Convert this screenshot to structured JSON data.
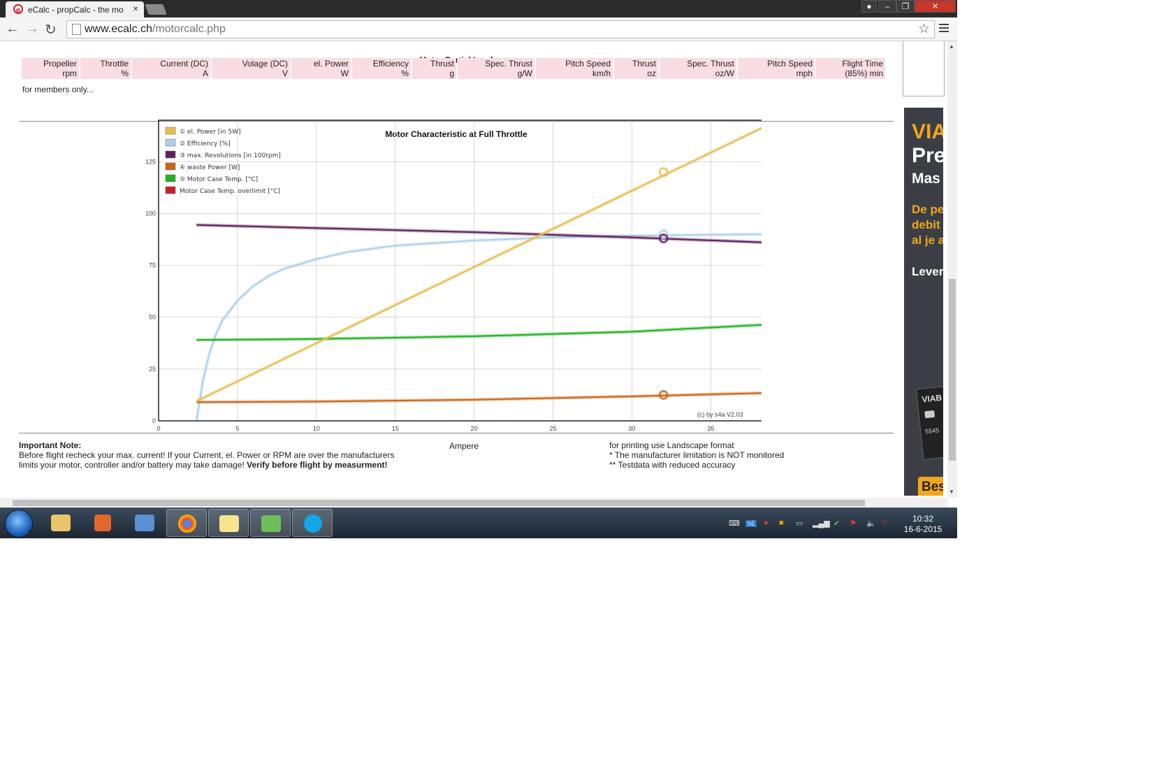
{
  "browser": {
    "tab_title": "eCalc - propCalc - the mo",
    "tab_close": "×",
    "url_host": "www.ecalc.ch",
    "url_path": "/motorcalc.php",
    "window_buttons": {
      "minimize": "–",
      "maximize": "❐",
      "close": "✕"
    }
  },
  "partial_load": {
    "title": "Motor Partial Load",
    "columns": [
      {
        "line1": "Propeller",
        "line2": "rpm"
      },
      {
        "line1": "Throttle",
        "line2": "%"
      },
      {
        "line1": "Current (DC)",
        "line2": "A"
      },
      {
        "line1": "Volage (DC)",
        "line2": "V"
      },
      {
        "line1": "el. Power",
        "line2": "W"
      },
      {
        "line1": "Efficiency",
        "line2": "%"
      },
      {
        "line1": "Thrust",
        "line2": "g"
      },
      {
        "line1": "Spec. Thrust",
        "line2": "g/W"
      },
      {
        "line1": "Pitch Speed",
        "line2": "km/h"
      },
      {
        "line1": "Thrust",
        "line2": "oz"
      },
      {
        "line1": "Spec. Thrust",
        "line2": "oz/W"
      },
      {
        "line1": "Pitch Speed",
        "line2": "mph"
      },
      {
        "line1": "Flight Time",
        "line2": "(85%) min"
      }
    ],
    "members_note": "for members only..."
  },
  "chart_data": {
    "type": "line",
    "title": "Motor Characteristic at Full Throttle",
    "xlabel": "Ampere",
    "ylabel": "",
    "xlim": [
      0,
      38.7
    ],
    "ylim": [
      0,
      145
    ],
    "x_ticks": [
      0,
      5,
      10,
      15,
      20,
      25,
      30,
      35
    ],
    "y_ticks": [
      0,
      25,
      50,
      75,
      100,
      125
    ],
    "grid": true,
    "legend_position": "top-left",
    "copyright": "(c) by s4a  V2.03",
    "series": [
      {
        "name": "① el. Power [in 5W]",
        "color": "#e9bc4f",
        "end_label": "①",
        "x": [
          2.4,
          38.7
        ],
        "y": [
          9.5,
          143
        ],
        "marker": {
          "x": 32,
          "y": 120
        }
      },
      {
        "name": "② Efficiency [%]",
        "color": "#aed0ea",
        "end_label": "②",
        "x": [
          2.4,
          2.8,
          3.2,
          3.6,
          4,
          5,
          6,
          7,
          8,
          10,
          12,
          15,
          20,
          25,
          30,
          35,
          38.7
        ],
        "y": [
          0,
          19,
          32,
          41,
          48,
          58,
          65,
          70,
          73.5,
          78,
          81.5,
          84.5,
          87,
          88.5,
          89.3,
          89.8,
          90
        ],
        "marker": {
          "x": 32,
          "y": 90
        }
      },
      {
        "name": "③ max. Revolutions [in 100rpm]",
        "color": "#5e1f5b",
        "end_label": "③",
        "x": [
          2.4,
          10,
          20,
          30,
          38.7
        ],
        "y": [
          94.5,
          93,
          91,
          88.5,
          86
        ],
        "marker": {
          "x": 32,
          "y": 88
        }
      },
      {
        "name": "④ waste Power [W]",
        "color": "#c8661a",
        "end_label": "④",
        "x": [
          2.4,
          10,
          20,
          30,
          38.7
        ],
        "y": [
          9,
          9.3,
          10.2,
          11.8,
          13.5
        ],
        "marker": {
          "x": 32,
          "y": 12.5
        }
      },
      {
        "name": "⑤ Motor Case Temp. [°C]",
        "color": "#22b022",
        "end_label": "⑤",
        "x": [
          2.4,
          10,
          20,
          30,
          38.7
        ],
        "y": [
          39,
          39.5,
          40.8,
          43,
          46.5
        ]
      },
      {
        "name": "Motor Case Temp. overlimit [°C]",
        "color": "#d01c2c"
      }
    ]
  },
  "notes": {
    "important_title": "Important Note:",
    "line1": "Before flight recheck your max. current! If your Current, el. Power or RPM are over the manufacturers",
    "line2a": "limits your motor, controller and/or battery may take damage! ",
    "line2b": "Verify before flight by measurment!",
    "right1": "for printing use Landscape format",
    "right2": "* The manufacturer limitation is NOT monitored",
    "right3": "** Testdata with reduced accuracy"
  },
  "ad": {
    "l1": "VIA",
    "l2": "Pre",
    "l3": "Mas",
    "l4a": "De pe",
    "l4b": "debit",
    "l4c": "al je a",
    "l5": "Lever",
    "card_text": "VIAB",
    "card_num": "5545",
    "button": "Bes"
  },
  "taskbar": {
    "apps": [
      "file-explorer",
      "media-player",
      "remote-app",
      "chrome",
      "sticky-notes",
      "messenger",
      "skype"
    ],
    "clock_time": "10:32",
    "clock_date": "16-6-2015",
    "tray_lang": "SE"
  }
}
